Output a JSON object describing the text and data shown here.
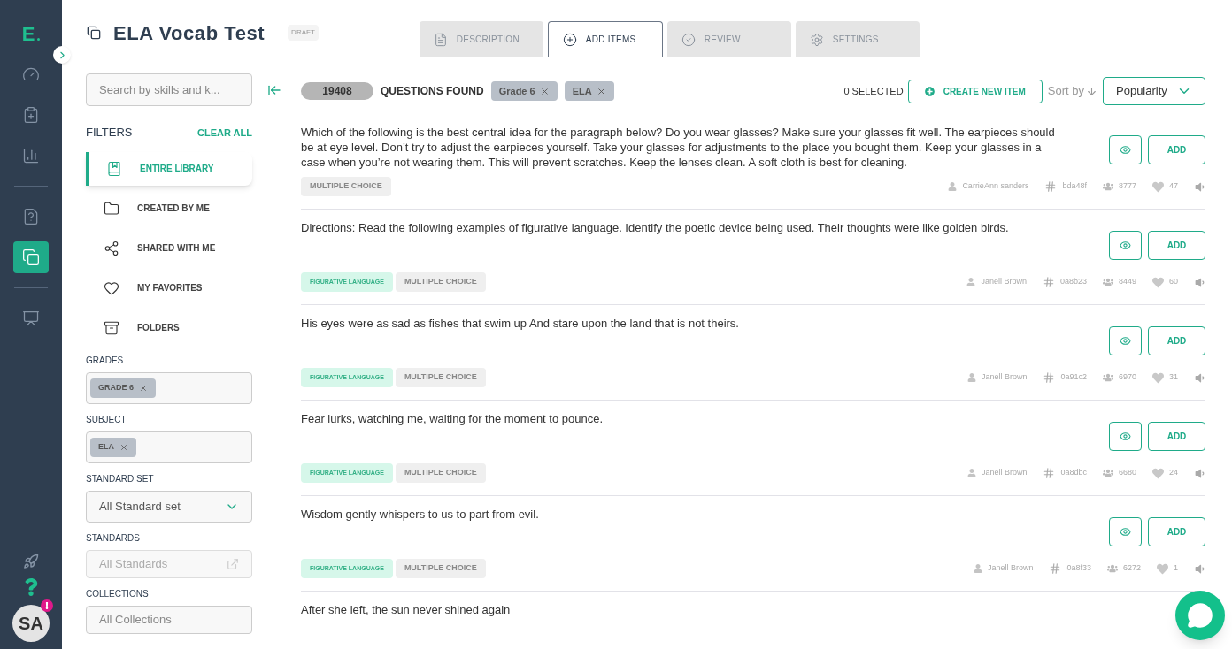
{
  "nav": {
    "logo": "E",
    "items": [
      {
        "selected": false
      },
      {
        "selected": false
      },
      {
        "selected": false
      },
      {
        "selected": false
      },
      {
        "selected": true
      },
      {
        "selected": false
      }
    ],
    "avatar": "SA"
  },
  "header": {
    "title": "ELA Vocab Test",
    "status": "DRAFT",
    "tabs": [
      {
        "label": "DESCRIPTION",
        "selected": false
      },
      {
        "label": "ADD ITEMS",
        "selected": true
      },
      {
        "label": "REVIEW",
        "selected": false
      },
      {
        "label": "SETTINGS",
        "selected": false
      }
    ]
  },
  "filters": {
    "search": {
      "placeholder": "Search by skills and k..."
    },
    "title": "FILTERS",
    "clear": "CLEAR ALL",
    "library": [
      {
        "label": "ENTIRE LIBRARY",
        "selected": true
      },
      {
        "label": "CREATED BY ME",
        "selected": false
      },
      {
        "label": "SHARED WITH ME",
        "selected": false
      },
      {
        "label": "MY FAVORITES",
        "selected": false
      },
      {
        "label": "FOLDERS",
        "selected": false
      }
    ],
    "fields": [
      {
        "kind": "chips",
        "label": "GRADES",
        "chips": [
          "GRADE 6"
        ]
      },
      {
        "kind": "chips",
        "label": "SUBJECT",
        "chips": [
          "ELA"
        ]
      },
      {
        "kind": "select",
        "label": "STANDARD SET",
        "value": "All Standard set"
      },
      {
        "kind": "link",
        "label": "STANDARDS",
        "placeholder": "All Standards"
      },
      {
        "kind": "text",
        "label": "COLLECTIONS",
        "placeholder": "All Collections"
      }
    ]
  },
  "results": {
    "count": "19408",
    "found": "QUESTIONS FOUND",
    "chips": [
      "Grade 6",
      "ELA"
    ],
    "selected": "0 SELECTED",
    "create": "CREATE NEW ITEM",
    "sort_label": "Sort by",
    "sort_value": "Popularity"
  },
  "items": [
    {
      "question": "Which of the following is the best central idea for the paragraph below?  Do you wear glasses? Make sure your glasses fit well. The earpieces should be at eye level. Don’t try to adjust the earpieces yourself. Take your glasses for adjustments to the place you bought them. Keep your glasses in a case when you’re not wearing them. This will prevent scratches. Keep the lenses clean. A soft cloth is best for cleaning.",
      "add": "ADD",
      "tags": [
        {
          "label": "MULTIPLE CHOICE",
          "kind": "type"
        }
      ],
      "author": "CarrieAnn sanders",
      "id": "bda48f",
      "uses": "8777",
      "likes": "47"
    },
    {
      "question": "Directions: Read the following examples of figurative language. Identify the poetic device being used. Their thoughts were like golden birds.",
      "add": "ADD",
      "tags": [
        {
          "label": "FIGURATIVE LANGUAGE",
          "kind": "skill"
        },
        {
          "label": "MULTIPLE CHOICE",
          "kind": "type"
        }
      ],
      "author": "Janell Brown",
      "id": "0a8b23",
      "uses": "8449",
      "likes": "60"
    },
    {
      "question": "His eyes were as sad as fishes that swim up And stare upon the land that is not theirs.",
      "add": "ADD",
      "tags": [
        {
          "label": "FIGURATIVE LANGUAGE",
          "kind": "skill"
        },
        {
          "label": "MULTIPLE CHOICE",
          "kind": "type"
        }
      ],
      "author": "Janell Brown",
      "id": "0a91c2",
      "uses": "6970",
      "likes": "31"
    },
    {
      "question": "Fear lurks, watching me, waiting for the moment to pounce.",
      "add": "ADD",
      "tags": [
        {
          "label": "FIGURATIVE LANGUAGE",
          "kind": "skill"
        },
        {
          "label": "MULTIPLE CHOICE",
          "kind": "type"
        }
      ],
      "author": "Janell Brown",
      "id": "0a8dbc",
      "uses": "6680",
      "likes": "24"
    },
    {
      "question": "Wisdom gently whispers to us to part from evil.",
      "add": "ADD",
      "tags": [
        {
          "label": "FIGURATIVE LANGUAGE",
          "kind": "skill"
        },
        {
          "label": "MULTIPLE CHOICE",
          "kind": "type"
        }
      ],
      "author": "Janell Brown",
      "id": "0a8f33",
      "uses": "6272",
      "likes": "1"
    },
    {
      "question": "After she left, the sun never shined again"
    }
  ]
}
